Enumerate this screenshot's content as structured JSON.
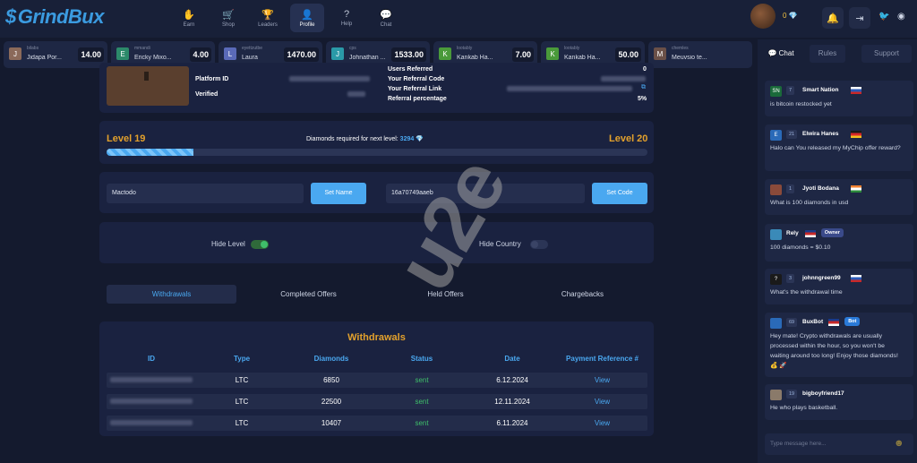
{
  "header": {
    "logo": "GrindBux",
    "balance": "0",
    "nav": [
      {
        "label": "Earn",
        "icon": "earn-icon"
      },
      {
        "label": "Shop",
        "icon": "cart-icon"
      },
      {
        "label": "Leaders",
        "icon": "trophy-icon"
      },
      {
        "label": "Profile",
        "icon": "user-icon"
      },
      {
        "label": "Help",
        "icon": "help-icon"
      },
      {
        "label": "Chat",
        "icon": "chat-icon"
      }
    ]
  },
  "ticker": [
    {
      "user": "bilabs",
      "game": "Jidapa Por...",
      "amount": "14.00",
      "avatar": "J",
      "color": "#8b6a5a"
    },
    {
      "user": "mmandi",
      "game": "Ericky Mixo...",
      "amount": "4.00",
      "avatar": "E",
      "color": "#2c8a6a"
    },
    {
      "user": "eyettzutbe",
      "game": "Laura",
      "amount": "1470.00",
      "avatar": "L",
      "color": "#5a6ab8"
    },
    {
      "user": "cps",
      "game": "Johnathan ...",
      "amount": "1533.00",
      "avatar": "J",
      "color": "#2a9aa8"
    },
    {
      "user": "lootably",
      "game": "Kankab Ha...",
      "amount": "7.00",
      "avatar": "K",
      "color": "#4a9a3a"
    },
    {
      "user": "lootably",
      "game": "Kankab Ha...",
      "amount": "50.00",
      "avatar": "K",
      "color": "#4a9a3a"
    },
    {
      "user": "chemles",
      "game": "Meuvsio te...",
      "amount": "",
      "avatar": "M",
      "color": "#6a5048"
    }
  ],
  "profile": {
    "platform_id_label": "Platform ID",
    "verified_label": "Verified",
    "users_referred_label": "Users Referred",
    "users_referred": "0",
    "referral_code_label": "Your Referral Code",
    "referral_link_label": "Your Referral Link",
    "referral_pct_label": "Referral percentage",
    "referral_pct": "5%"
  },
  "level": {
    "current": "Level 19",
    "next": "Level 20",
    "required_label": "Diamonds required for next level:",
    "required_value": "3294",
    "progress": 0.16
  },
  "settings": {
    "name_value": "Mactodo",
    "set_name": "Set Name",
    "code_value": "16a70749aaeb",
    "set_code": "Set Code",
    "hide_level": "Hide Level",
    "hide_country": "Hide Country"
  },
  "tabs": [
    "Withdrawals",
    "Completed Offers",
    "Held Offers",
    "Chargebacks"
  ],
  "withdrawals": {
    "title": "Withdrawals",
    "columns": [
      "ID",
      "Type",
      "Diamonds",
      "Status",
      "Date",
      "Payment Reference #"
    ],
    "rows": [
      {
        "type": "LTC",
        "diamonds": "6850",
        "status": "sent",
        "date": "6.12.2024",
        "ref": "View"
      },
      {
        "type": "LTC",
        "diamonds": "22500",
        "status": "sent",
        "date": "12.11.2024",
        "ref": "View"
      },
      {
        "type": "LTC",
        "diamonds": "10407",
        "status": "sent",
        "date": "6.11.2024",
        "ref": "View"
      }
    ]
  },
  "chat": {
    "tabs": [
      "Chat",
      "Rules",
      "Support"
    ],
    "placeholder": "Type message here...",
    "messages": [
      {
        "level": "7",
        "name": "Smart Nation",
        "text": "is bitcoin restocked yet",
        "avatar": "SN",
        "color": "#1a6a3a"
      },
      {
        "level": "21",
        "name": "Elwira Hanes",
        "text": "Halo can You released my MyChip offer reward?",
        "avatar": "E",
        "color": "#2a6ab8"
      },
      {
        "level": "1",
        "name": "Jyoti Bodana",
        "text": "What is 100 diamonds in usd",
        "avatar": "",
        "color": "#8a4a3a"
      },
      {
        "level": "",
        "name": "Rely",
        "text": "100 diamonds = $0.10",
        "avatar": "",
        "color": "#3a8ab8",
        "badge": "Owner"
      },
      {
        "level": "3",
        "name": "johnngreen99",
        "text": "What's the withdrawal time",
        "avatar": "?",
        "color": "#1a1a1a"
      },
      {
        "level": "69",
        "name": "BuxBot",
        "text": "Hey mate! Crypto withdrawals are usually processed within the hour, so you won't be waiting around too long! Enjoy those diamonds! 💰 🚀",
        "avatar": "",
        "color": "#2a6ab8",
        "badge": "Bot"
      },
      {
        "level": "19",
        "name": "bigboyfriend17",
        "text": "He who plays basketball.",
        "avatar": "",
        "color": "#8a7a6a"
      }
    ]
  },
  "watermark": "u2e",
  "colors": {
    "accent": "#4aa8f0",
    "gold": "#e3a12c",
    "sent": "#3fbf6a"
  }
}
